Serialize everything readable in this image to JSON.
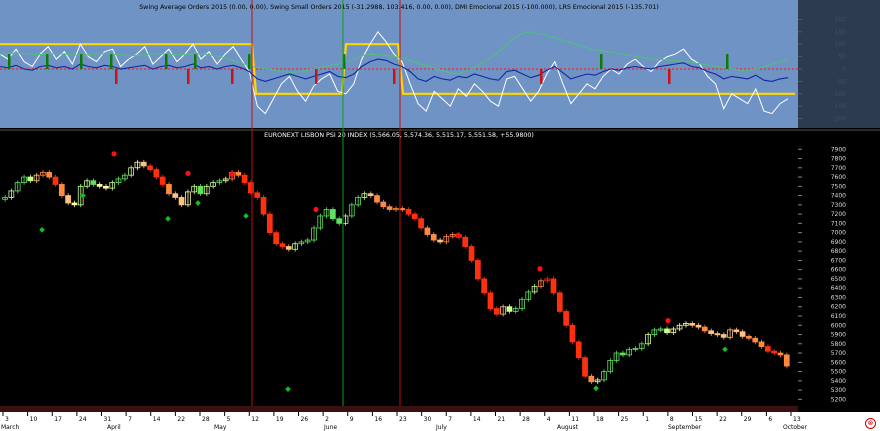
{
  "chart_data": [
    {
      "type": "line",
      "title": "Swing Average Orders 2015 (0.00, 0.00), Swing Small Orders 2015 (-31.2988, 103.416, 0.00, 0.00), DMI Emocional 2015 (-100.000), LRS Emocional 2015 (-135.701)",
      "ylim": [
        -230,
        230
      ],
      "y_ticks": [
        200,
        150,
        100,
        50,
        0,
        -50,
        -100,
        -150,
        -200
      ],
      "zero_line": 0,
      "series": [
        {
          "name": "yellow_state",
          "color": "#ffd700",
          "segments": [
            [
              0,
              100
            ],
            [
              252,
              100
            ],
            [
              256,
              -100
            ],
            [
              342,
              -100
            ],
            [
              346,
              100
            ],
            [
              398,
              100
            ],
            [
              403,
              -100
            ],
            [
              795,
              -100
            ]
          ]
        },
        {
          "name": "white_osc",
          "color": "#ffffff",
          "values": [
            60,
            40,
            80,
            30,
            10,
            60,
            90,
            40,
            70,
            20,
            100,
            50,
            30,
            70,
            80,
            10,
            40,
            60,
            90,
            20,
            50,
            80,
            30,
            60,
            100,
            40,
            70,
            20,
            60,
            90,
            40,
            -10,
            -150,
            -180,
            -120,
            -60,
            -30,
            -90,
            -130,
            -70,
            -40,
            -20,
            -90,
            -100,
            -60,
            40,
            100,
            150,
            110,
            60,
            30,
            -60,
            -140,
            -170,
            -90,
            -120,
            -150,
            -80,
            -110,
            -60,
            -90,
            -130,
            -150,
            -40,
            -30,
            -80,
            -130,
            -90,
            -20,
            30,
            -60,
            -140,
            -100,
            -60,
            -80,
            -30,
            0,
            -20,
            20,
            40,
            10,
            -10,
            30,
            50,
            60,
            80,
            40,
            20,
            -30,
            -60,
            -160,
            -100,
            -120,
            -140,
            -80,
            -170,
            -180,
            -140,
            -120
          ]
        },
        {
          "name": "blue_line",
          "color": "#1028a0",
          "values": [
            10,
            5,
            15,
            0,
            -5,
            10,
            15,
            5,
            10,
            0,
            20,
            10,
            5,
            15,
            10,
            0,
            5,
            10,
            15,
            0,
            10,
            15,
            5,
            10,
            20,
            5,
            10,
            0,
            10,
            15,
            5,
            -10,
            -40,
            -50,
            -40,
            -30,
            -20,
            -30,
            -40,
            -30,
            -20,
            -10,
            -30,
            -35,
            -20,
            10,
            30,
            40,
            35,
            20,
            10,
            -10,
            -40,
            -50,
            -30,
            -40,
            -45,
            -30,
            -35,
            -20,
            -30,
            -40,
            -45,
            -10,
            -5,
            -20,
            -35,
            -25,
            -5,
            10,
            -15,
            -40,
            -30,
            -20,
            -25,
            -10,
            0,
            -5,
            5,
            10,
            5,
            0,
            10,
            15,
            20,
            25,
            10,
            5,
            -10,
            -20,
            -40,
            -30,
            -35,
            -40,
            -25,
            -45,
            -50,
            -40,
            -35
          ]
        },
        {
          "name": "green_line",
          "color": "#4fbf7f",
          "values": [
            60,
            62,
            65,
            63,
            60,
            58,
            60,
            62,
            60,
            58,
            55,
            57,
            60,
            62,
            60,
            58,
            56,
            55,
            57,
            60,
            62,
            60,
            58,
            57,
            60,
            62,
            60,
            55,
            50,
            40,
            30,
            20,
            10,
            5,
            0,
            -5,
            -10,
            -15,
            -10,
            -5,
            0,
            10,
            15,
            20,
            30,
            40,
            55,
            60,
            58,
            55,
            50,
            45,
            35,
            25,
            15,
            5,
            -5,
            -15,
            -20,
            -10,
            0,
            20,
            40,
            60,
            90,
            120,
            140,
            150,
            145,
            140,
            130,
            120,
            110,
            100,
            90,
            80,
            75,
            70,
            65,
            60,
            55,
            50,
            45,
            40,
            38,
            35,
            33,
            30,
            25,
            20,
            15,
            10,
            5,
            0,
            -5,
            -5,
            0,
            10,
            20,
            30,
            40
          ]
        },
        {
          "name": "red_dotted",
          "color": "#ff2020",
          "values": [
            0
          ]
        }
      ],
      "histogram_up": [
        [
          8,
          1
        ],
        [
          46,
          1
        ],
        [
          80,
          1
        ],
        [
          110,
          1
        ],
        [
          165,
          1
        ],
        [
          194,
          1
        ],
        [
          248,
          1
        ],
        [
          343,
          1
        ],
        [
          600,
          1
        ],
        [
          726,
          1
        ]
      ],
      "histogram_down": [
        [
          115,
          1
        ],
        [
          187,
          1
        ],
        [
          231,
          1
        ],
        [
          315,
          1
        ],
        [
          393,
          1
        ],
        [
          540,
          1
        ],
        [
          668,
          1
        ]
      ],
      "grid": false
    },
    {
      "type": "candlestick",
      "title": "EURONEXT LISBON PSI 20 INDEX (5,566.05, 5,574.36, 5,515.17, 5,551.58, +55.9800)",
      "ylim": [
        5150,
        8000
      ],
      "y_ticks": [
        7900,
        7800,
        7700,
        7600,
        7500,
        7400,
        7300,
        7200,
        7100,
        7000,
        6900,
        6800,
        6700,
        6600,
        6500,
        6400,
        6300,
        6200,
        6100,
        6000,
        5900,
        5800,
        5700,
        5600,
        5500,
        5400,
        5300,
        5200
      ],
      "closes": [
        7380,
        7450,
        7540,
        7600,
        7560,
        7620,
        7650,
        7600,
        7520,
        7400,
        7320,
        7300,
        7500,
        7560,
        7520,
        7500,
        7480,
        7540,
        7580,
        7620,
        7700,
        7760,
        7720,
        7680,
        7600,
        7520,
        7420,
        7380,
        7300,
        7440,
        7500,
        7420,
        7500,
        7540,
        7560,
        7580,
        7650,
        7620,
        7540,
        7430,
        7380,
        7200,
        7000,
        6880,
        6850,
        6820,
        6880,
        6900,
        6920,
        7050,
        7180,
        7250,
        7150,
        7100,
        7180,
        7300,
        7380,
        7420,
        7400,
        7330,
        7280,
        7250,
        7260,
        7250,
        7200,
        7150,
        7050,
        6980,
        6920,
        6900,
        6960,
        6980,
        6950,
        6850,
        6700,
        6500,
        6350,
        6180,
        6120,
        6200,
        6150,
        6180,
        6280,
        6360,
        6420,
        6480,
        6500,
        6350,
        6150,
        6000,
        5820,
        5650,
        5450,
        5390,
        5410,
        5500,
        5620,
        5700,
        5680,
        5740,
        5750,
        5800,
        5900,
        5950,
        5960,
        5920,
        5960,
        6000,
        6020,
        6000,
        5980,
        5940,
        5910,
        5900,
        5870,
        5950,
        5930,
        5880,
        5860,
        5820,
        5770,
        5720,
        5700,
        5680,
        5560
      ],
      "markers_up": [
        [
          42,
          7030
        ],
        [
          83,
          7400
        ],
        [
          168,
          7150
        ],
        [
          198,
          7320
        ],
        [
          246,
          7180
        ],
        [
          288,
          5310
        ],
        [
          596,
          5320
        ],
        [
          725,
          5740
        ]
      ],
      "markers_down": [
        [
          114,
          7850
        ],
        [
          188,
          7640
        ],
        [
          232,
          7630
        ],
        [
          316,
          7250
        ],
        [
          458,
          6970
        ],
        [
          540,
          6610
        ],
        [
          668,
          6050
        ]
      ],
      "grid": false
    }
  ],
  "x_axis": {
    "day_labels": [
      "3",
      "10",
      "17",
      "24",
      "31",
      "7",
      "14",
      "22",
      "28",
      "5",
      "12",
      "19",
      "26",
      "2",
      "9",
      "16",
      "23",
      "30",
      "7",
      "14",
      "21",
      "28",
      "4",
      "11",
      "18",
      "25",
      "1",
      "8",
      "15",
      "22",
      "29",
      "6",
      "13"
    ],
    "month_labels": [
      "March",
      "April",
      "May",
      "June",
      "July",
      "August",
      "September",
      "October"
    ]
  }
}
